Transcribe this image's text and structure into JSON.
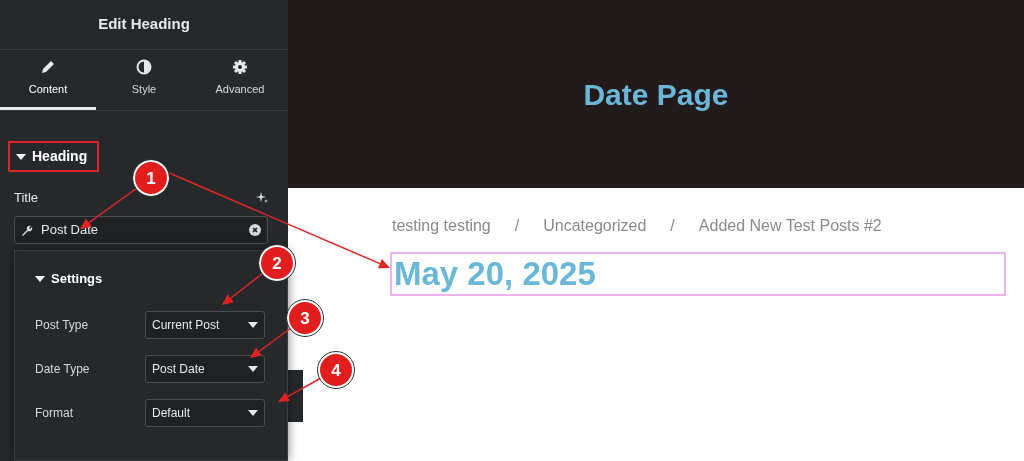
{
  "panel": {
    "title": "Edit Heading",
    "tabs": [
      {
        "label": "Content",
        "kind": "pencil",
        "selected": true
      },
      {
        "label": "Style",
        "kind": "contrast",
        "selected": false
      },
      {
        "label": "Advanced",
        "kind": "gear",
        "selected": false
      }
    ],
    "section": {
      "title": "Heading",
      "expanded": true,
      "outlined": true
    },
    "field": {
      "label": "Title",
      "value": "Post Date"
    },
    "popover": {
      "title": "Settings",
      "expanded": true,
      "rows": [
        {
          "label": "Post Type",
          "value": "Current Post"
        },
        {
          "label": "Date Type",
          "value": "Post Date"
        },
        {
          "label": "Format",
          "value": "Default"
        }
      ]
    }
  },
  "page": {
    "banner_title": "Date Page",
    "breadcrumb": {
      "items": [
        "testing testing",
        "Uncategorized",
        "Added New Test Posts #2"
      ],
      "separators": [
        "/",
        "/"
      ]
    },
    "date": {
      "text": "May 20, 2025",
      "selected": true
    }
  },
  "callouts": [
    {
      "number": "1"
    },
    {
      "number": "2"
    },
    {
      "number": "3"
    },
    {
      "number": "4"
    }
  ]
}
